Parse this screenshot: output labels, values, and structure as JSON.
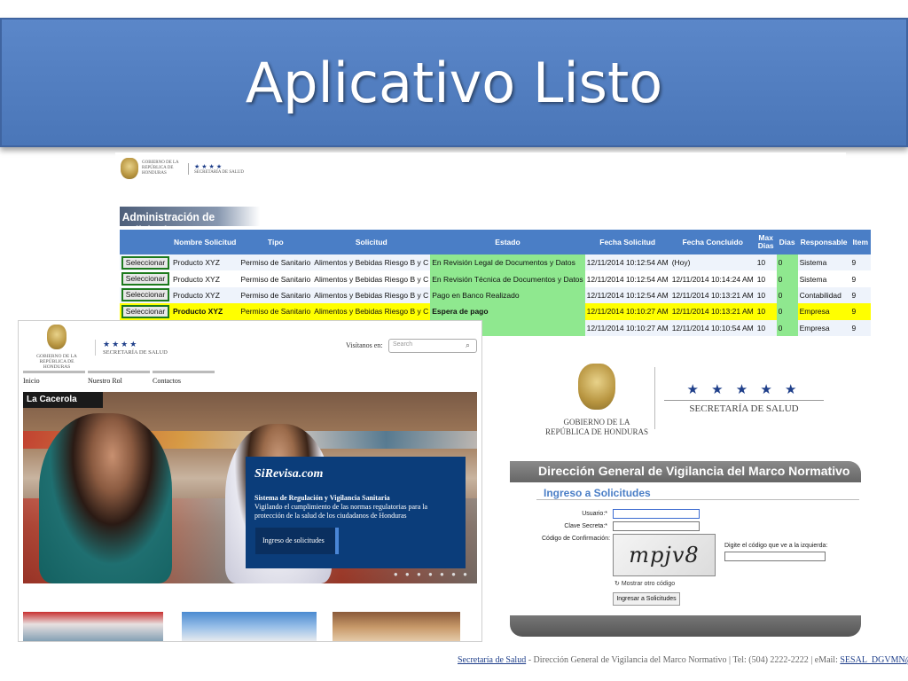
{
  "slide": {
    "title": "Aplicativo Listo"
  },
  "admin": {
    "logo": {
      "gov": "GOBIERNO DE LA REPÚBLICA DE HONDURAS",
      "stars": "★★★★",
      "ministry": "SECRETARÍA DE SALUD"
    },
    "header": "Administración de Solicitudes",
    "columns": [
      "",
      "Nombre Solicitud",
      "Tipo",
      "Solicitud",
      "Estado",
      "Fecha Solicitud",
      "Fecha Concluido",
      "Max Dias",
      "Dias",
      "Responsable",
      "Item"
    ],
    "rows": [
      {
        "button": "Seleccionar",
        "nombre": "Producto XYZ",
        "tipo": "Permiso de Sanitario",
        "solicitud": "Alimentos y Bebidas Riesgo B y C",
        "estado": "En Revisión Legal de Documentos y Datos",
        "fecha_solicitud": "12/11/2014 10:12:54 AM",
        "fecha_concluido": "(Hoy)",
        "max_dias": "10",
        "dias": "0",
        "responsable": "Sistema",
        "item": "9"
      },
      {
        "button": "Seleccionar",
        "nombre": "Producto XYZ",
        "tipo": "Permiso de Sanitario",
        "solicitud": "Alimentos y Bebidas Riesgo B y C",
        "estado": "En Revisión Técnica de Documentos y Datos",
        "fecha_solicitud": "12/11/2014 10:12:54 AM",
        "fecha_concluido": "12/11/2014 10:14:24 AM",
        "max_dias": "10",
        "dias": "0",
        "responsable": "Sistema",
        "item": "9"
      },
      {
        "button": "Seleccionar",
        "nombre": "Producto XYZ",
        "tipo": "Permiso de Sanitario",
        "solicitud": "Alimentos y Bebidas Riesgo B y C",
        "estado": "Pago en Banco Realizado",
        "fecha_solicitud": "12/11/2014 10:12:54 AM",
        "fecha_concluido": "12/11/2014 10:13:21 AM",
        "max_dias": "10",
        "dias": "0",
        "responsable": "Contabilidad",
        "item": "9"
      },
      {
        "button": "Seleccionar",
        "nombre": "Producto XYZ",
        "tipo": "Permiso de Sanitario",
        "solicitud": "Alimentos y Bebidas Riesgo B y C",
        "estado": "Espera de pago",
        "fecha_solicitud": "12/11/2014 10:10:27 AM",
        "fecha_concluido": "12/11/2014 10:13:21 AM",
        "max_dias": "10",
        "dias": "0",
        "responsable": "Empresa",
        "item": "9"
      },
      {
        "button": "",
        "nombre": "",
        "tipo": "",
        "solicitud": "",
        "estado": "",
        "fecha_solicitud": "12/11/2014 10:10:27 AM",
        "fecha_concluido": "12/11/2014 10:10:54 AM",
        "max_dias": "10",
        "dias": "0",
        "responsable": "Empresa",
        "item": "9"
      }
    ]
  },
  "site": {
    "logo": {
      "gov": "GOBIERNO DE LA REPÚBLICA DE HONDURAS",
      "stars": "★★★★",
      "ministry": "SECRETARÍA DE SALUD"
    },
    "visit_label": "Visítanos en:",
    "search_placeholder": "Search",
    "nav": [
      "Inicio",
      "Nuestro Rol",
      "Contactos"
    ],
    "hero": {
      "sign": "La Cacerola",
      "brand": "SiRevisa.com",
      "title": "Sistema de Regulación y Vigilancia Sanitaria",
      "description": "Vigilando el cumplimiento de las normas regulatorias para la protección de la salud de los ciudadanos de Honduras",
      "cta": "Ingreso de solicitudes",
      "dots": "● ● ● ● ● ● ●"
    }
  },
  "login": {
    "logo": {
      "gov": "GOBIERNO DE LA REPÚBLICA DE HONDURAS",
      "stars": "★ ★ ★ ★ ★",
      "ministry": "SECRETARÍA DE SALUD"
    },
    "header": "Dirección General de Vigilancia del Marco Normativo",
    "subtitle": "Ingreso a Solicitudes",
    "user_label": "Usuario:*",
    "password_label": "Clave Secreta:*",
    "code_label": "Código de Confirmación:",
    "captcha_text": "mpjv8",
    "captcha_hint": "Digite el código que ve a la izquierda:",
    "refresh_label": "Mostrar otro código",
    "submit_label": "Ingresar a Solicitudes"
  },
  "footer": {
    "link": "Secretaría de Salud",
    "text": " - Dirección General de Vigilancia del Marco Normativo | Tel: (504) 2222-2222 | eMail: ",
    "email": "SESAL_DGVMN@sirevisa.n"
  }
}
